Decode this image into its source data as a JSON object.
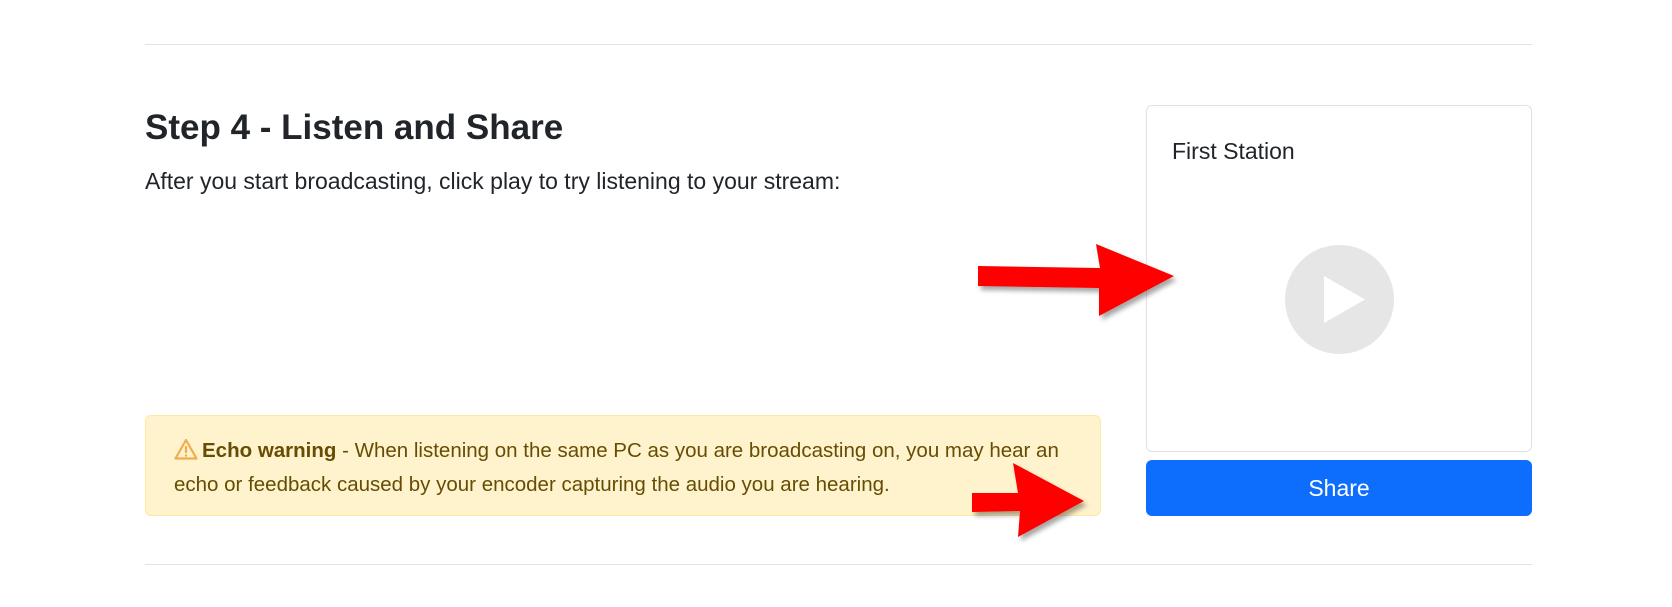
{
  "step": {
    "title": "Step 4 - Listen and Share",
    "description": "After you start broadcasting, click play to try listening to your stream:"
  },
  "warning": {
    "icon": "warning-triangle-icon",
    "title": "Echo warning",
    "text": " - When listening on the same PC as you are broadcasting on, you may hear an echo or feedback caused by your encoder capturing the audio you are hearing."
  },
  "player": {
    "station_name": "First Station",
    "play_icon": "play-icon"
  },
  "share": {
    "label": "Share"
  },
  "annotations": {
    "arrow_color": "#ff0000",
    "arrows": [
      "arrow-to-play-button",
      "arrow-to-share-button"
    ]
  },
  "colors": {
    "primary": "#0d6efd",
    "warning_bg": "#fff3cd",
    "warning_text": "#664d03",
    "play_bg": "#e6e6e6"
  }
}
